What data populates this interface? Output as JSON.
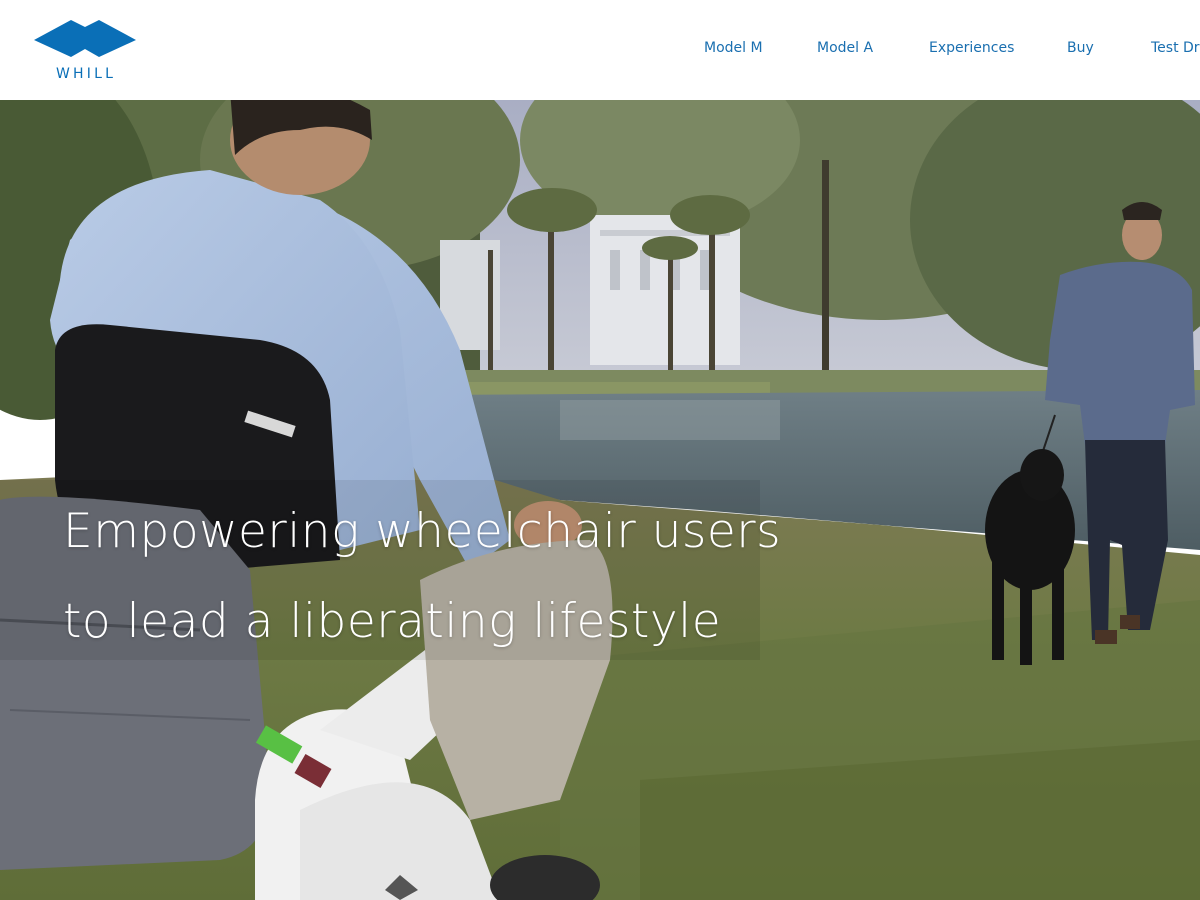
{
  "brand": {
    "logo_text": "WHILL",
    "accent_color": "#0a6fb7"
  },
  "nav": {
    "items": [
      {
        "label": "Model M"
      },
      {
        "label": "Model A"
      },
      {
        "label": "Experiences"
      },
      {
        "label": "Buy"
      },
      {
        "label": "Test Dri"
      }
    ]
  },
  "hero": {
    "line1": "Empowering wheelchair users",
    "line2": "to lead a liberating lifestyle",
    "image_description_icon": "hero-photo"
  }
}
